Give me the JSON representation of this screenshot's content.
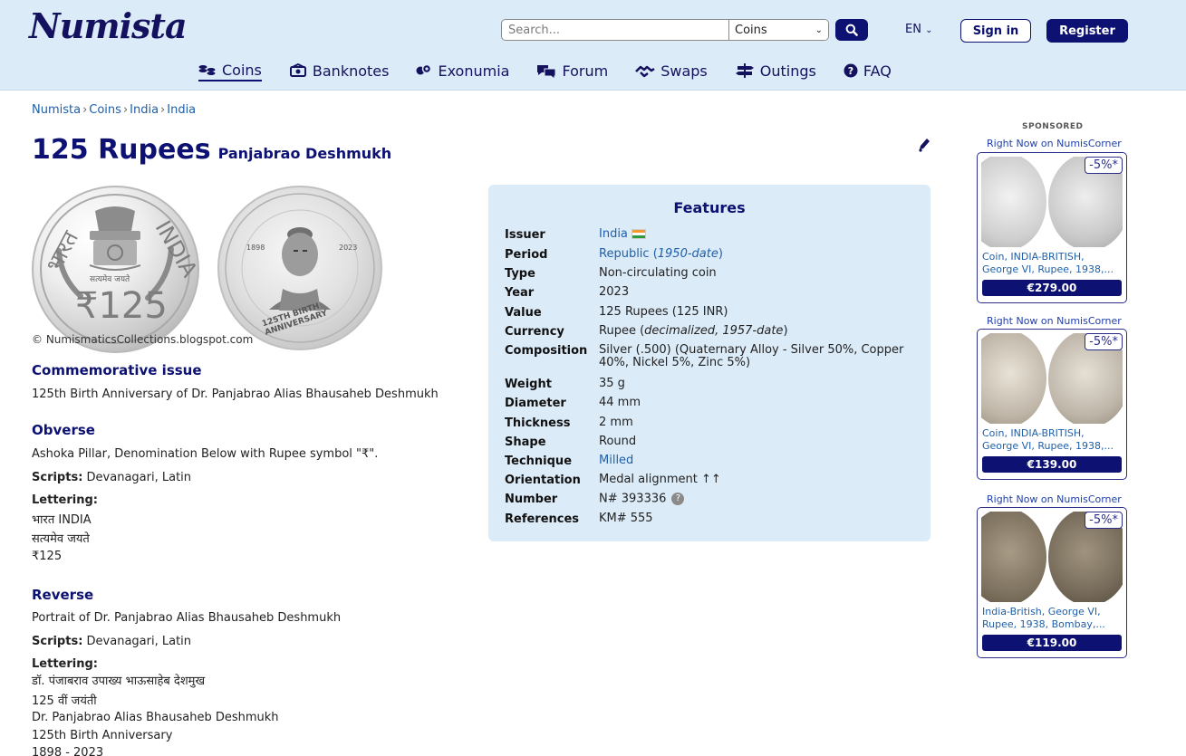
{
  "header": {
    "logo": "Numista",
    "search_placeholder": "Search...",
    "search_category": "Coins",
    "language": "EN",
    "signin_label": "Sign in",
    "register_label": "Register"
  },
  "nav": [
    {
      "label": "Coins",
      "icon": "coins-icon",
      "active": true
    },
    {
      "label": "Banknotes",
      "icon": "banknote-icon"
    },
    {
      "label": "Exonumia",
      "icon": "exonumia-icon"
    },
    {
      "label": "Forum",
      "icon": "forum-icon"
    },
    {
      "label": "Swaps",
      "icon": "handshake-icon"
    },
    {
      "label": "Outings",
      "icon": "signpost-icon"
    },
    {
      "label": "FAQ",
      "icon": "question-icon"
    }
  ],
  "breadcrumb": [
    "Numista",
    "Coins",
    "India",
    "India"
  ],
  "title": {
    "main": "125 Rupees",
    "sub": "Panjabrao Deshmukh"
  },
  "coin_text": {
    "obverse_left": "भारत",
    "obverse_right": "INDIA",
    "obverse_motto": "सत्यमेव जयते",
    "obverse_denom": "₹125",
    "reverse_years_left": "1898",
    "reverse_years_right": "2023",
    "reverse_ring": "125TH BIRTH ANNIVERSARY"
  },
  "image_credit": "© NumismaticsCollections.blogspot.com",
  "commemorative": {
    "heading": "Commemorative issue",
    "text": "125th Birth Anniversary of Dr. Panjabrao Alias Bhausaheb Deshmukh"
  },
  "obverse": {
    "heading": "Obverse",
    "description": "Ashoka Pillar, Denomination Below with Rupee symbol \"₹\".",
    "scripts_label": "Scripts:",
    "scripts": "Devanagari, Latin",
    "lettering_label": "Lettering:",
    "lettering": [
      "भारत INDIA",
      "सत्यमेव जयते",
      "₹125"
    ]
  },
  "reverse": {
    "heading": "Reverse",
    "description": "Portrait of Dr. Panjabrao Alias Bhausaheb Deshmukh",
    "scripts_label": "Scripts:",
    "scripts": "Devanagari, Latin",
    "lettering_label": "Lettering:",
    "lettering": [
      "डॉ. पंजाबराव उपाख्य भाऊसाहेब देशमुख",
      "125 वीं जयंती",
      "Dr. Panjabrao Alias Bhausaheb Deshmukh",
      "125th Birth Anniversary",
      "1898 - 2023"
    ]
  },
  "features": {
    "heading": "Features",
    "rows": [
      {
        "key": "Issuer",
        "value": "India"
      },
      {
        "key": "Period",
        "value": "Republic (",
        "value_em": "1950-date",
        "value_end": ")"
      },
      {
        "key": "Type",
        "value": "Non-circulating coin"
      },
      {
        "key": "Year",
        "value": "2023"
      },
      {
        "key": "Value",
        "value": "125 Rupees (125 INR)"
      },
      {
        "key": "Currency",
        "value": "Rupee (",
        "value_em": "decimalized, 1957-date",
        "value_end": ")"
      },
      {
        "key": "Composition",
        "value": "Silver (.500) (Quaternary Alloy - Silver 50%, Copper 40%, Nickel 5%, Zinc 5%)"
      },
      {
        "key": "Weight",
        "value": "35 g"
      },
      {
        "key": "Diameter",
        "value": "44 mm"
      },
      {
        "key": "Thickness",
        "value": "2 mm"
      },
      {
        "key": "Shape",
        "value": "Round"
      },
      {
        "key": "Technique",
        "value": "Milled"
      },
      {
        "key": "Orientation",
        "value": "Medal alignment ↑↑"
      },
      {
        "key": "Number",
        "value": "N# 393336"
      },
      {
        "key": "References",
        "value": "KM# 555"
      }
    ]
  },
  "sponsored": {
    "label": "SPONSORED",
    "ads": [
      {
        "source": "Right Now on NumisCorner",
        "discount": "-5%*",
        "desc_line1": "Coin, INDIA-BRITISH,",
        "desc_line2": "George VI, Rupee, 1938,...",
        "price": "€279.00"
      },
      {
        "source": "Right Now on NumisCorner",
        "discount": "-5%*",
        "desc_line1": "Coin, INDIA-BRITISH,",
        "desc_line2": "George VI, Rupee, 1938,...",
        "price": "€139.00"
      },
      {
        "source": "Right Now on NumisCorner",
        "discount": "-5%*",
        "desc_line1": "India-British, George VI,",
        "desc_line2": "Rupee, 1938, Bombay,...",
        "price": "€119.00"
      }
    ]
  },
  "colors": {
    "brand_navy": "#0c1172",
    "header_bg": "#dcebf8",
    "link_blue": "#1f5fa8"
  }
}
